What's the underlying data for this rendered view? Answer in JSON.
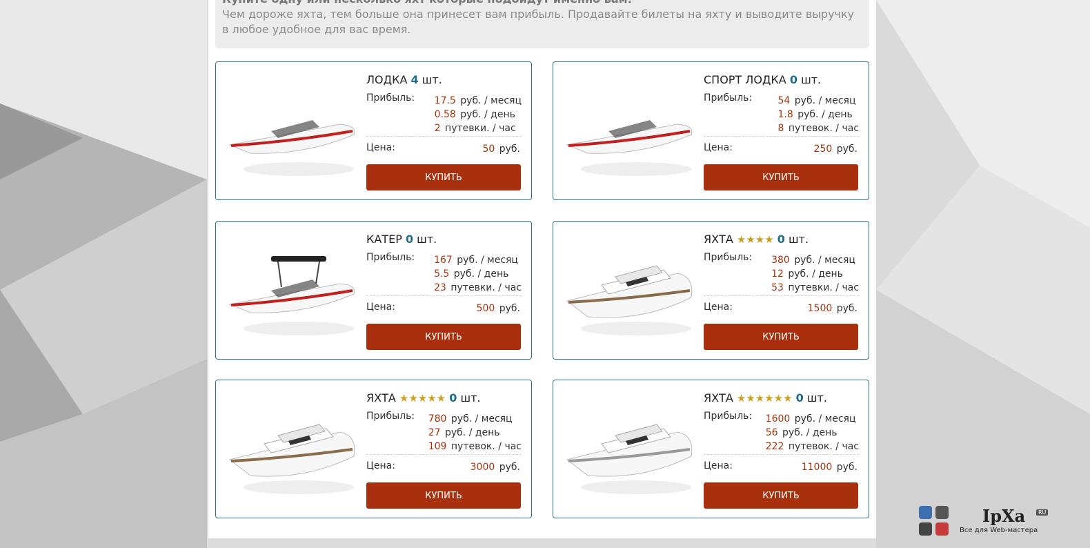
{
  "intro": {
    "heading": "Купите одну или несколько яхт которые подойдут именно вам.",
    "text": "Чем дороже яхта, тем больше она принесет вам прибыль. Продавайте билеты на яхту и выводите выручку в любое удобное для вас время."
  },
  "labels": {
    "profit": "Прибыль:",
    "price": "Цена:",
    "qty_unit": "шт.",
    "rub": "руб.",
    "per_month": "руб. / месяц",
    "per_day": "руб. / день",
    "buy": "КУПИТЬ"
  },
  "cards": [
    {
      "name": "ЛОДКА",
      "stars": "",
      "qty": "4",
      "month": "17.5",
      "day": "0.58",
      "trips": "2",
      "trips_unit": "путевки. / час",
      "price": "50"
    },
    {
      "name": "СПОРТ ЛОДКА",
      "stars": "",
      "qty": "0",
      "month": "54",
      "day": "1.8",
      "trips": "8",
      "trips_unit": "путевок. / час",
      "price": "250"
    },
    {
      "name": "КАТЕР",
      "stars": "",
      "qty": "0",
      "month": "167",
      "day": "5.5",
      "trips": "23",
      "trips_unit": "путевки. / час",
      "price": "500"
    },
    {
      "name": "ЯХТА",
      "stars": "★★★★",
      "qty": "0",
      "month": "380",
      "day": "12",
      "trips": "53",
      "trips_unit": "путевки. / час",
      "price": "1500"
    },
    {
      "name": "ЯХТА",
      "stars": "★★★★★",
      "qty": "0",
      "month": "780",
      "day": "27",
      "trips": "109",
      "trips_unit": "путевок. / час",
      "price": "3000"
    },
    {
      "name": "ЯХТА",
      "stars": "★★★★★★",
      "qty": "0",
      "month": "1600",
      "day": "56",
      "trips": "222",
      "trips_unit": "путевок. / час",
      "price": "11000"
    }
  ],
  "watermark": {
    "brand": "IpXa",
    "domain": "RU",
    "tagline": "Все для Web-мастера"
  },
  "colors": {
    "accent": "#a8300c",
    "qty": "#1f6e87",
    "stars": "#c7a026",
    "border": "#2e6f86"
  }
}
